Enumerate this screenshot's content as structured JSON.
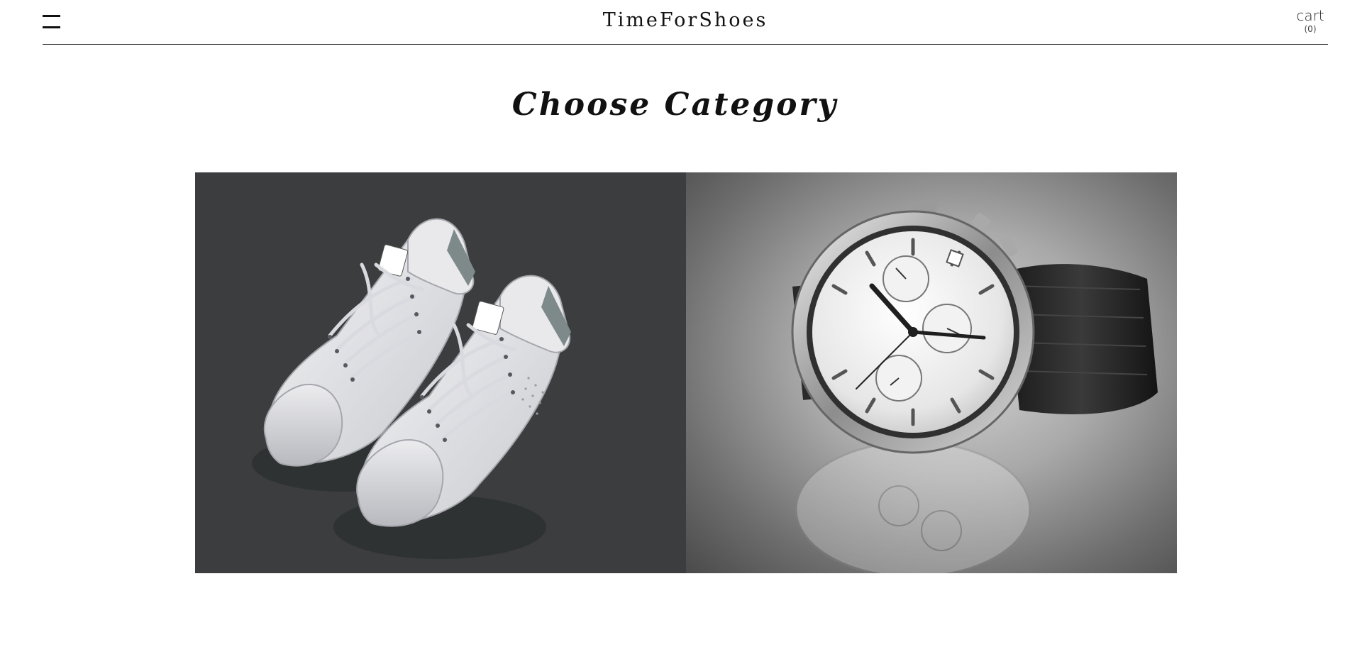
{
  "header": {
    "brand": "TimeForShoes",
    "menu_icon": "hamburger-menu-icon",
    "cart_label": "cart",
    "cart_count": "(0)"
  },
  "main": {
    "title": "Choose Category",
    "categories": [
      {
        "image": "white-sneakers-image",
        "background": "#3b3d3e"
      },
      {
        "image": "wristwatch-image",
        "background": "#8c8c8c"
      }
    ]
  },
  "colors": {
    "text": "#111111",
    "divider": "#2a2a2a",
    "background": "#ffffff"
  }
}
